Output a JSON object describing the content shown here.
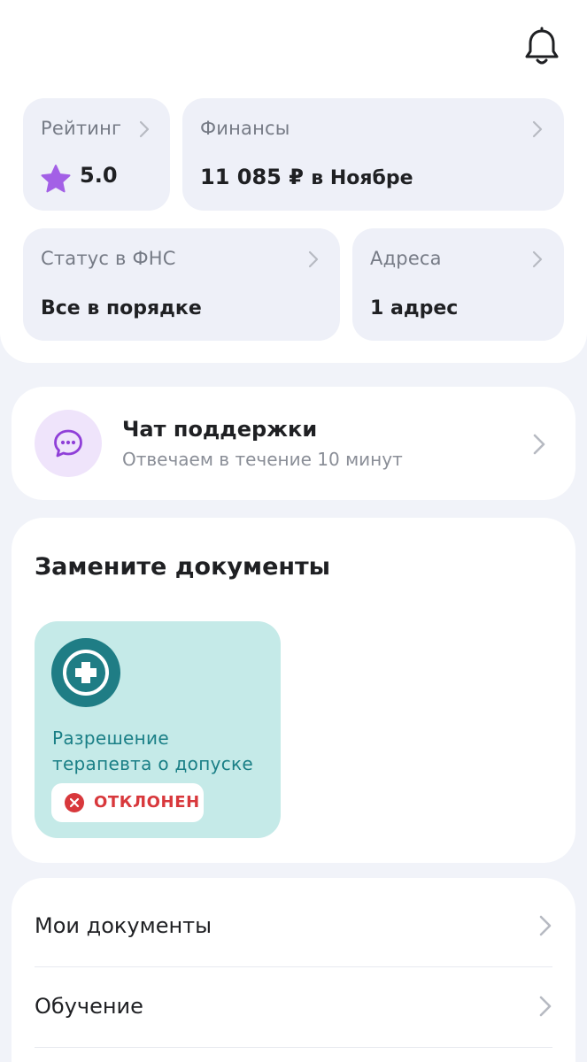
{
  "header": {
    "notifications_icon": "bell-icon"
  },
  "tiles": {
    "rating": {
      "label": "Рейтинг",
      "value": "5.0",
      "icon": "star-icon",
      "icon_color": "#a360e6"
    },
    "finance": {
      "label": "Финансы",
      "amount": "11 085 ₽",
      "period": "в Ноябре"
    },
    "fns": {
      "label": "Статус в ФНС",
      "value": "Все в порядке"
    },
    "addresses": {
      "label": "Адреса",
      "value": "1 адрес"
    }
  },
  "support": {
    "title": "Чат поддержки",
    "subtitle": "Отвечаем в течение 10 минут",
    "icon": "chat-bubble-icon"
  },
  "replace_documents": {
    "title": "Замените документы",
    "items": [
      {
        "name": "Разрешение терапевта о допуске",
        "icon": "medical-cross-icon",
        "status": "ОТКЛОНЕН",
        "status_icon": "error-icon"
      }
    ]
  },
  "menu": {
    "items": [
      {
        "label": "Мои документы"
      },
      {
        "label": "Обучение"
      }
    ]
  },
  "colors": {
    "accent_purple": "#a360e6",
    "teal": "#1a7f86",
    "teal_bg": "#c5eae8",
    "error_red": "#d8383c",
    "tile_bg": "#eef0f8",
    "page_bg": "#f1f3f9"
  }
}
